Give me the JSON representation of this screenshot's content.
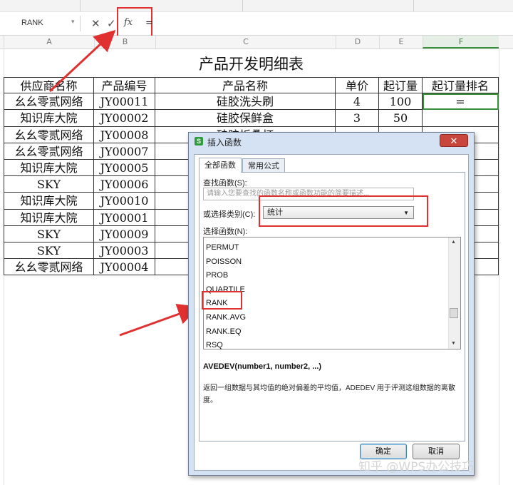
{
  "formula_bar": {
    "name_box_value": "RANK",
    "cancel_symbol": "✕",
    "confirm_symbol": "✓",
    "fx_label": "fx",
    "formula_text": "="
  },
  "columns": [
    "A",
    "B",
    "C",
    "D",
    "E",
    "F"
  ],
  "active_column": "F",
  "sheet": {
    "title": "产品开发明细表",
    "headers": [
      "供应商名称",
      "产品编号",
      "产品名称",
      "单价",
      "起订量",
      "起订量排名"
    ],
    "rows": [
      [
        "幺幺零贰网络",
        "JY00011",
        "硅胶洗头刷",
        "4",
        "100",
        "="
      ],
      [
        "知识库大院",
        "JY00002",
        "硅胶保鲜盒",
        "3",
        "50",
        ""
      ],
      [
        "幺幺零贰网络",
        "JY00008",
        "硅胶折叠杯",
        "",
        "",
        ""
      ],
      [
        "幺幺零贰网络",
        "JY00007",
        "",
        "",
        "",
        ""
      ],
      [
        "知识库大院",
        "JY00005",
        "",
        "",
        "",
        ""
      ],
      [
        "SKY",
        "JY00006",
        "",
        "",
        "",
        ""
      ],
      [
        "知识库大院",
        "JY00010",
        "",
        "",
        "",
        ""
      ],
      [
        "知识库大院",
        "JY00001",
        "",
        "",
        "",
        ""
      ],
      [
        "SKY",
        "JY00009",
        "",
        "",
        "",
        ""
      ],
      [
        "SKY",
        "JY00003",
        "",
        "",
        "",
        ""
      ],
      [
        "幺幺零贰网络",
        "JY00004",
        "",
        "",
        "",
        ""
      ]
    ]
  },
  "dialog": {
    "title": "插入函数",
    "close_symbol": "✕",
    "icon_glyph": "S",
    "tabs": [
      "全部函数",
      "常用公式"
    ],
    "search_label": "查找函数(S):",
    "search_placeholder": "请输入您要查找的函数名称或函数功能的简要描述...",
    "category_label": "或选择类别(C):",
    "category_value": "统计",
    "dropdown_symbol": "▼",
    "function_list_label": "选择函数(N):",
    "functions": [
      "PERMUT",
      "POISSON",
      "PROB",
      "QUARTILE",
      "RANK",
      "RANK.AVG",
      "RANK.EQ",
      "RSQ"
    ],
    "highlighted_function": "RANK",
    "signature": "AVEDEV(number1, number2, ...)",
    "description": "返回一组数据与其均值的绝对偏差的平均值，ADEDEV 用于评测这组数据的离散度。",
    "ok_label": "确定",
    "cancel_label": "取消"
  },
  "watermark": "知乎 @WPS办公技巧",
  "colors": {
    "annotation_red": "#e03030",
    "active_green": "#3a8f3a",
    "dialog_frame": "#d4e2f3"
  }
}
